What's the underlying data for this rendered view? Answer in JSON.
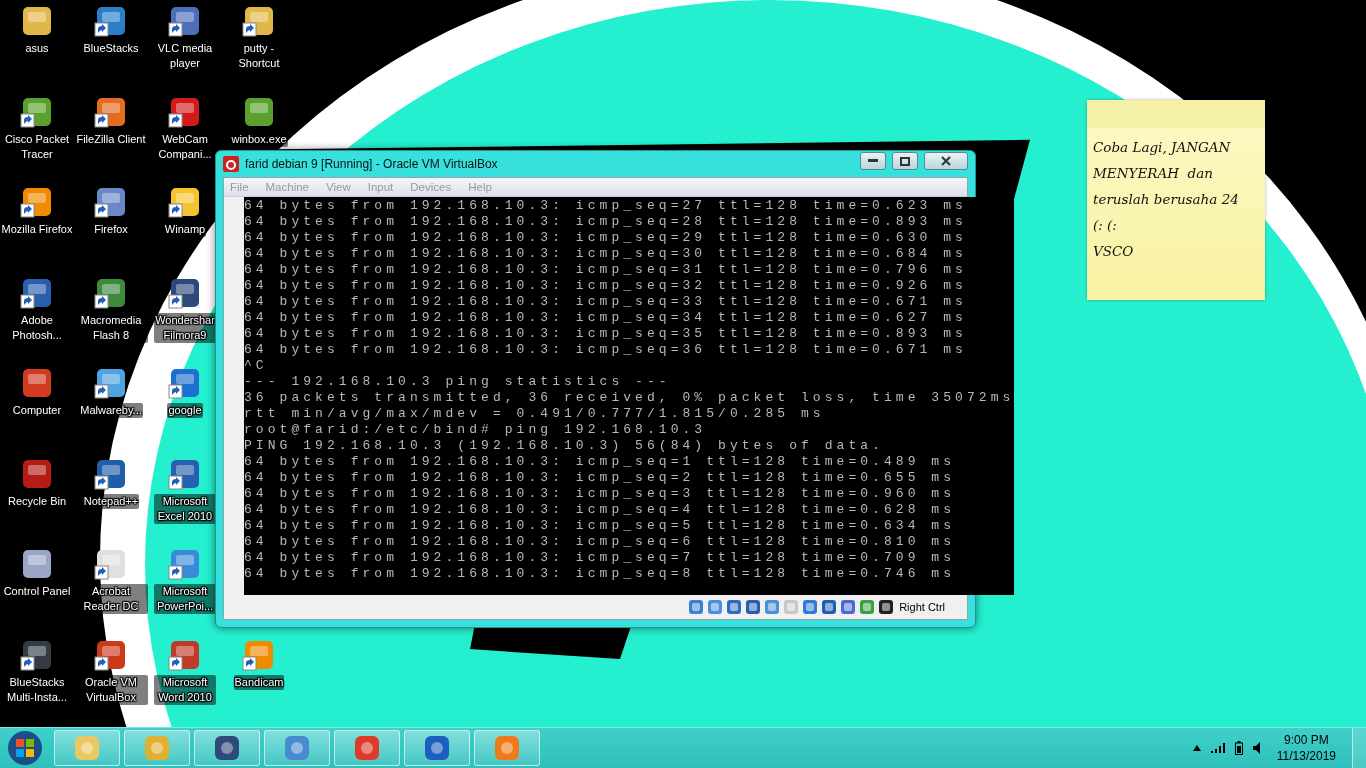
{
  "desktop_columns": [
    [
      {
        "label": "asus",
        "shortcut": false
      },
      {
        "label": "Cisco Packet Tracer",
        "shortcut": true
      },
      {
        "label": "Mozilla Firefox",
        "shortcut": true
      },
      {
        "label": "Adobe Photosh...",
        "shortcut": true
      },
      {
        "label": "Computer",
        "shortcut": false
      },
      {
        "label": "Recycle Bin",
        "shortcut": false
      },
      {
        "label": "Control Panel",
        "shortcut": false
      },
      {
        "label": "BlueStacks Multi-Insta...",
        "shortcut": true
      }
    ],
    [
      {
        "label": "BlueStacks",
        "shortcut": true
      },
      {
        "label": "FileZilla Client",
        "shortcut": true
      },
      {
        "label": "Firefox",
        "shortcut": true
      },
      {
        "label": "Macromedia Flash 8",
        "shortcut": true
      },
      {
        "label": "Malwareby...",
        "shortcut": true
      },
      {
        "label": "Notepad++",
        "shortcut": true
      },
      {
        "label": "Acrobat Reader DC",
        "shortcut": true
      },
      {
        "label": "Oracle VM VirtualBox",
        "shortcut": true
      }
    ],
    [
      {
        "label": "VLC media player",
        "shortcut": true
      },
      {
        "label": "WebCam Compani...",
        "shortcut": true
      },
      {
        "label": "Winamp",
        "shortcut": true
      },
      {
        "label": "Wondershar Filmora9",
        "shortcut": true
      },
      {
        "label": "google",
        "shortcut": true
      },
      {
        "label": "Microsoft Excel 2010",
        "shortcut": true
      },
      {
        "label": "Microsoft PowerPoi...",
        "shortcut": true
      },
      {
        "label": "Microsoft Word 2010",
        "shortcut": true
      }
    ],
    [
      {
        "label": "putty - Shortcut",
        "shortcut": true
      },
      {
        "label": "winbox.exe",
        "shortcut": false
      },
      {
        "label": "Bandicam",
        "shortcut": true
      }
    ]
  ],
  "vm_window": {
    "title": "farid debian 9 [Running] - Oracle VM VirtualBox",
    "menu": [
      "File",
      "Machine",
      "View",
      "Input",
      "Devices",
      "Help"
    ],
    "terminal_lines": [
      "64 bytes from 192.168.10.3: icmp_seq=27 ttl=128 time=0.623 ms",
      "64 bytes from 192.168.10.3: icmp_seq=28 ttl=128 time=0.893 ms",
      "64 bytes from 192.168.10.3: icmp_seq=29 ttl=128 time=0.630 ms",
      "64 bytes from 192.168.10.3: icmp_seq=30 ttl=128 time=0.684 ms",
      "64 bytes from 192.168.10.3: icmp_seq=31 ttl=128 time=0.796 ms",
      "64 bytes from 192.168.10.3: icmp_seq=32 ttl=128 time=0.926 ms",
      "64 bytes from 192.168.10.3: icmp_seq=33 ttl=128 time=0.671 ms",
      "64 bytes from 192.168.10.3: icmp_seq=34 ttl=128 time=0.627 ms",
      "64 bytes from 192.168.10.3: icmp_seq=35 ttl=128 time=0.893 ms",
      "64 bytes from 192.168.10.3: icmp_seq=36 ttl=128 time=0.671 ms",
      "^C",
      "--- 192.168.10.3 ping statistics ---",
      "36 packets transmitted, 36 received, 0% packet loss, time 35072ms",
      "rtt min/avg/max/mdev = 0.491/0.777/1.815/0.285 ms",
      "root@farid:/etc/bind# ping 192.168.10.3",
      "PING 192.168.10.3 (192.168.10.3) 56(84) bytes of data.",
      "64 bytes from 192.168.10.3: icmp_seq=1 ttl=128 time=0.489 ms",
      "64 bytes from 192.168.10.3: icmp_seq=2 ttl=128 time=0.655 ms",
      "64 bytes from 192.168.10.3: icmp_seq=3 ttl=128 time=0.960 ms",
      "64 bytes from 192.168.10.3: icmp_seq=4 ttl=128 time=0.628 ms",
      "64 bytes from 192.168.10.3: icmp_seq=5 ttl=128 time=0.634 ms",
      "64 bytes from 192.168.10.3: icmp_seq=6 ttl=128 time=0.810 ms",
      "64 bytes from 192.168.10.3: icmp_seq=7 ttl=128 time=0.709 ms",
      "64 bytes from 192.168.10.3: icmp_seq=8 ttl=128 time=0.746 ms"
    ],
    "host_key": "Right Ctrl"
  },
  "sticky_note": {
    "lines": [
      "Coba Lagi, JANGAN",
      "MENYERAH  dan",
      "teruslah berusaha 24",
      "(: (:",
      "VSCO"
    ]
  },
  "taskbar": {
    "time": "9:00 PM",
    "date": "11/13/2019"
  }
}
